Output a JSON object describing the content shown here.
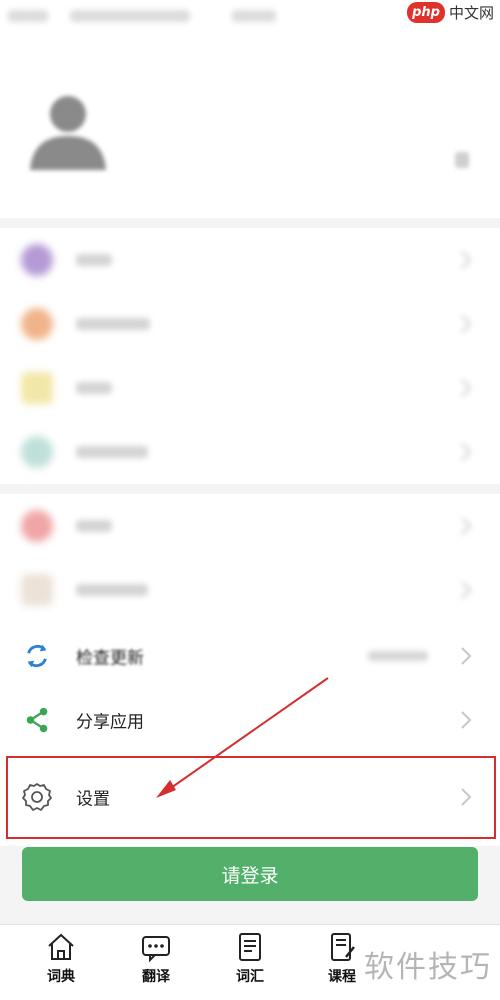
{
  "watermark_top": {
    "logo": "php",
    "site": "中文网"
  },
  "menu": {
    "check_update": "检查更新",
    "share_app": "分享应用",
    "settings": "设置"
  },
  "login_button": "请登录",
  "tabs": [
    {
      "label": "词典",
      "icon": "house-icon"
    },
    {
      "label": "翻译",
      "icon": "chat-bubble-icon"
    },
    {
      "label": "词汇",
      "icon": "notebook-icon"
    },
    {
      "label": "课程",
      "icon": "document-pen-icon"
    }
  ],
  "watermark_bottom": "软件技巧",
  "colors": {
    "accent_green": "#52b06a",
    "highlight_red": "#d32f2f",
    "update_blue": "#2e7fd8"
  }
}
